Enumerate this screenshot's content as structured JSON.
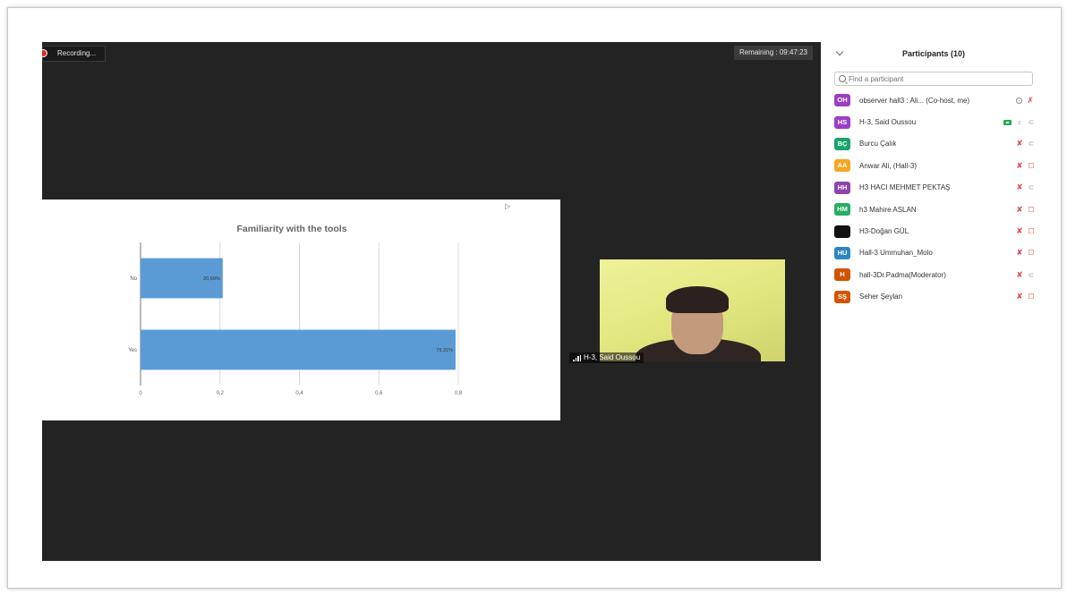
{
  "meeting": {
    "recording_label": "Recording...",
    "remaining_label": "Remaining : 09:47:23",
    "video_tile_name": "H-3, Said Oussou"
  },
  "chart_data": {
    "type": "bar",
    "orientation": "horizontal",
    "title": "Familiarity with the tools",
    "categories": [
      "No",
      "Yes"
    ],
    "values": [
      0.2069,
      0.7931
    ],
    "data_labels": [
      "20,69%",
      "79,31%"
    ],
    "xlim": [
      0,
      0.8
    ],
    "x_ticks": [
      "0",
      "0,2",
      "0,4",
      "0,6",
      "0,8"
    ],
    "grid": true,
    "bar_color": "#5b9bd5"
  },
  "participants": {
    "title": "Participants (10)",
    "search_placeholder": "Find a participant",
    "items": [
      {
        "initials": "OH",
        "color": "#9b3fc4",
        "name": "observer hall3 : Ali... (Co-host, me)",
        "mic": "target",
        "cam": "muted"
      },
      {
        "initials": "HS",
        "color": "#9b3fc4",
        "name": "H-3, Said Oussou",
        "mic": "on",
        "cam": "on"
      },
      {
        "initials": "BÇ",
        "color": "#1aa36c",
        "name": "Burcu Çalık",
        "mic": "muted",
        "cam": "off"
      },
      {
        "initials": "AA",
        "color": "#f5a623",
        "name": "Anwar Ali, (Hall-3)",
        "mic": "muted",
        "cam": "off-red"
      },
      {
        "initials": "HH",
        "color": "#8e44ad",
        "name": "H3 HACI MEHMET PEKTAŞ",
        "mic": "muted",
        "cam": "off"
      },
      {
        "initials": "HM",
        "color": "#27ae60",
        "name": "h3 Mahire ASLAN",
        "mic": "muted",
        "cam": "off-red"
      },
      {
        "initials": "",
        "color": "#111111",
        "name": "H3-Doğan GÜL",
        "mic": "muted",
        "cam": "off-red"
      },
      {
        "initials": "HU",
        "color": "#2e86c1",
        "name": "Hall-3 Ummuhan_Molo",
        "mic": "muted",
        "cam": "off-red"
      },
      {
        "initials": "H",
        "color": "#d35400",
        "name": "hall-3Dr.Padma(Moderator)",
        "mic": "muted",
        "cam": "off"
      },
      {
        "initials": "SŞ",
        "color": "#d35400",
        "name": "Seher Şeylan",
        "mic": "muted",
        "cam": "off-red"
      }
    ]
  }
}
